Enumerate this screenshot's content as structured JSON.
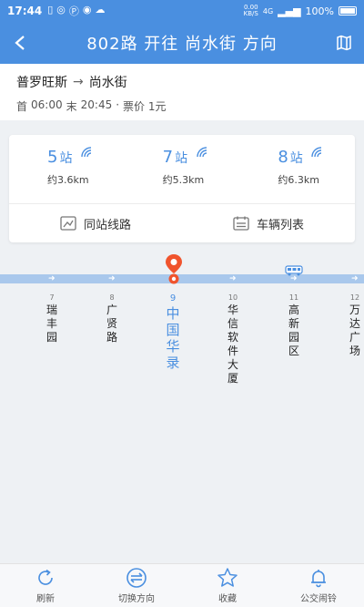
{
  "status_bar": {
    "time": "17:44",
    "speed_value": "0.00",
    "speed_unit": "KB/S",
    "network": "4G",
    "battery": "100%"
  },
  "header": {
    "title": "802路 开往 尚水街 方向"
  },
  "route": {
    "from": "普罗旺斯",
    "to": "尚水街",
    "first_label": "首",
    "first_time": "06:00",
    "last_label": "末",
    "last_time": "20:45",
    "fare": "票价 1元"
  },
  "arrivals": [
    {
      "stops": "5",
      "unit": "站",
      "distance": "约3.6km"
    },
    {
      "stops": "7",
      "unit": "站",
      "distance": "约5.3km"
    },
    {
      "stops": "8",
      "unit": "站",
      "distance": "约6.3km"
    }
  ],
  "actions": {
    "same_station_lines": "同站线路",
    "vehicle_list": "车辆列表"
  },
  "stations": [
    {
      "num": "7",
      "name": "瑞丰园"
    },
    {
      "num": "8",
      "name": "广贤路"
    },
    {
      "num": "9",
      "name": "中国华录"
    },
    {
      "num": "10",
      "name": "华信软件大厦"
    },
    {
      "num": "11",
      "name": "高新园区"
    },
    {
      "num": "12",
      "name": "万达广场"
    }
  ],
  "bottom_nav": {
    "refresh": "刷新",
    "switch_direction": "切换方向",
    "favorite": "收藏",
    "alarm": "公交闹铃"
  },
  "colors": {
    "primary": "#4a8fe0",
    "route_bar": "#a9c8ec",
    "pin": "#f0542d"
  }
}
